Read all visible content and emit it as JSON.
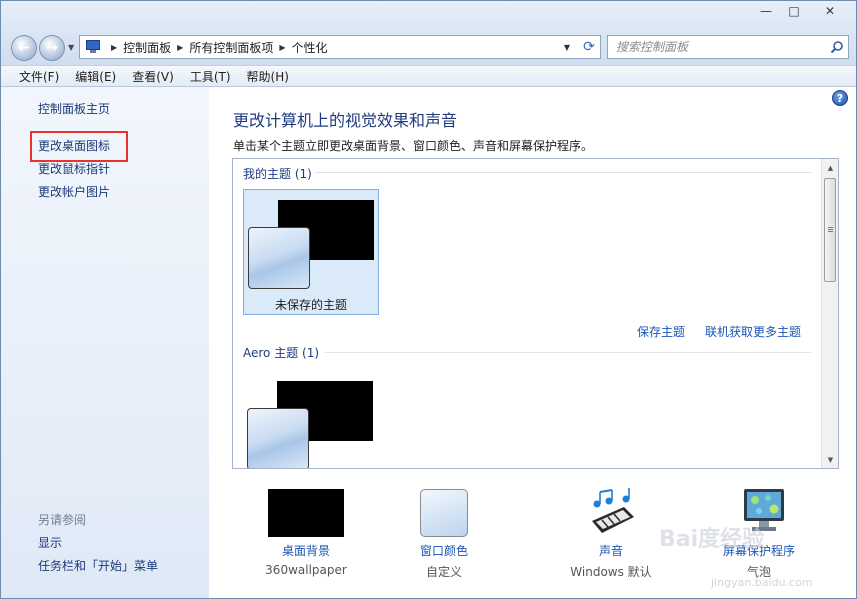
{
  "window": {
    "caption": {
      "minimize": "—",
      "maximize": "□",
      "close": "✕"
    }
  },
  "address": {
    "crumbs": [
      "控制面板",
      "所有控制面板项",
      "个性化"
    ],
    "search_placeholder": "搜索控制面板"
  },
  "menu": [
    "文件(F)",
    "编辑(E)",
    "查看(V)",
    "工具(T)",
    "帮助(H)"
  ],
  "left_pane": {
    "home": "控制面板主页",
    "links": [
      "更改桌面图标",
      "更改鼠标指针",
      "更改帐户图片"
    ],
    "see_also_title": "另请参阅",
    "see_also": [
      "显示",
      "任务栏和「开始」菜单"
    ]
  },
  "main": {
    "title": "更改计算机上的视觉效果和声音",
    "description": "单击某个主题立即更改桌面背景、窗口颜色、声音和屏幕保护程序。",
    "my_themes": {
      "heading": "我的主题 (1)",
      "items": [
        {
          "label": "未保存的主题",
          "selected": true
        }
      ]
    },
    "save_theme": "保存主题",
    "get_more_themes": "联机获取更多主题",
    "aero_themes": {
      "heading": "Aero 主题 (1)"
    },
    "bottom": [
      {
        "label": "桌面背景",
        "sub": "360wallpaper"
      },
      {
        "label": "窗口颜色",
        "sub": "自定义"
      },
      {
        "label": "声音",
        "sub": "Windows 默认"
      },
      {
        "label": "屏幕保护程序",
        "sub": "气泡"
      }
    ]
  },
  "icons": {
    "back": "back-arrow-icon",
    "forward": "forward-arrow-icon",
    "refresh": "refresh-icon",
    "search": "search-icon",
    "help": "help-icon"
  },
  "watermark": {
    "text": "Bai度经验",
    "sub": "jingyan.baidu.com"
  },
  "colors": {
    "link": "#1b56b8",
    "title": "#1e3b80",
    "highlight": "#e8322d"
  }
}
